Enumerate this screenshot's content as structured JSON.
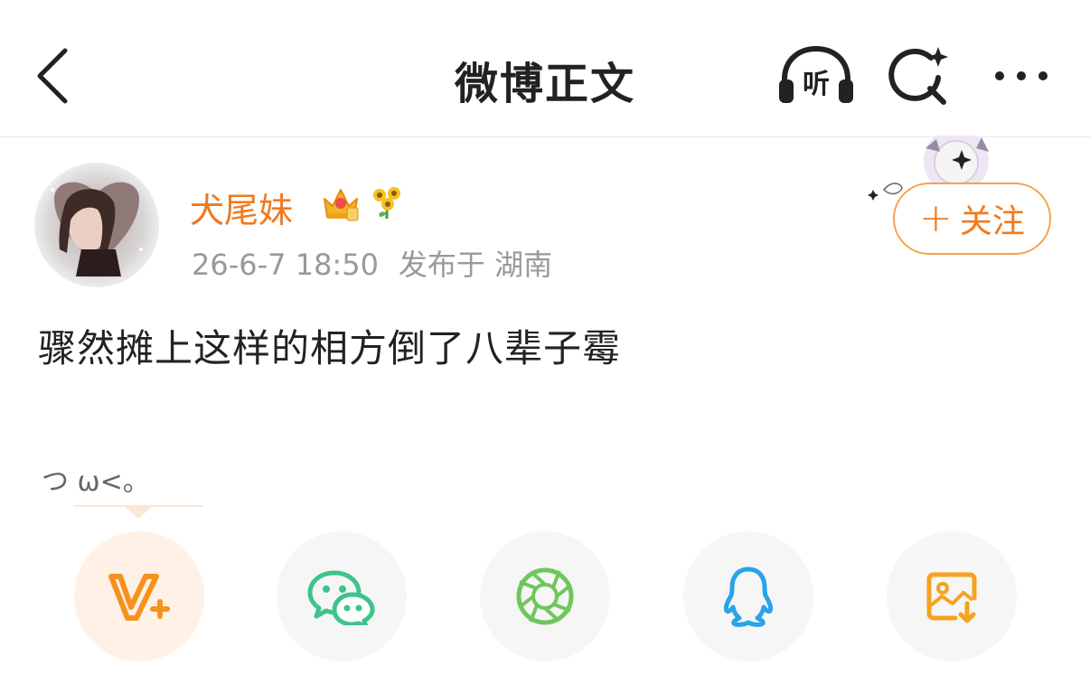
{
  "header": {
    "title": "微博正文",
    "listen_label": "听"
  },
  "post": {
    "author": {
      "name": "犬尾妹",
      "badges": [
        "crown-badge",
        "sunflower-badge"
      ]
    },
    "date": "26-6-7 18:50",
    "location": "发布于 湖南",
    "follow_label": "关注",
    "follow_plus": "+",
    "text": "骤然摊上这样的相方倒了八辈子霉",
    "kaomoji": "つ ω<。"
  },
  "share_options": [
    {
      "name": "vplus",
      "icon": "v-plus-icon",
      "color": "#f7911e"
    },
    {
      "name": "wechat",
      "icon": "wechat-icon",
      "color": "#3cc48b"
    },
    {
      "name": "moments",
      "icon": "moments-icon",
      "color": "#6ec75c"
    },
    {
      "name": "qq",
      "icon": "qq-icon",
      "color": "#2aa3e8"
    },
    {
      "name": "save-image",
      "icon": "save-image-icon",
      "color": "#f7a21e"
    }
  ],
  "colors": {
    "accent": "#f0791e",
    "text_primary": "#222222",
    "text_secondary": "#999999"
  }
}
